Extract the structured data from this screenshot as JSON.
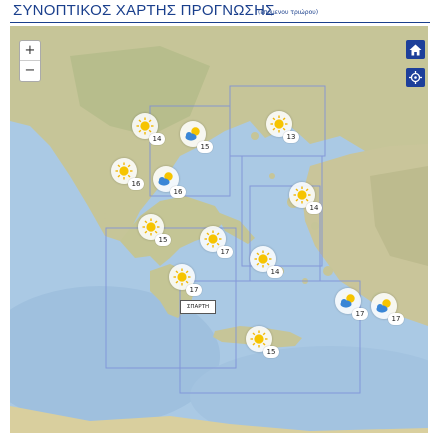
{
  "header": {
    "title": "ΣΥΝΟΠΤΙΚΟΣ ΧΑΡΤΗΣ ΠΡΟΓΝΩΣΗΣ",
    "subtitle": "(επόμενου τριώρου)"
  },
  "map": {
    "zoom_in_label": "+",
    "zoom_out_label": "−",
    "home_icon": "home-icon",
    "locate_icon": "crosshair-icon",
    "colors": {
      "sea": "#aac9e4",
      "land": "#c8c89a",
      "accent": "#1d3f9a",
      "region_border": "#7d8fd8"
    },
    "city_label": "ΣΠΑΡΤΗ",
    "forecasts": [
      {
        "weather": "sunny",
        "temp": "14"
      },
      {
        "weather": "partly-cloudy",
        "temp": "15"
      },
      {
        "weather": "sunny",
        "temp": "13"
      },
      {
        "weather": "sunny",
        "temp": "16"
      },
      {
        "weather": "partly-cloudy",
        "temp": "16"
      },
      {
        "weather": "sunny",
        "temp": "14"
      },
      {
        "weather": "sunny",
        "temp": "15"
      },
      {
        "weather": "sunny",
        "temp": "17"
      },
      {
        "weather": "sunny",
        "temp": "14"
      },
      {
        "weather": "sunny",
        "temp": "17"
      },
      {
        "weather": "partly-cloudy",
        "temp": "17"
      },
      {
        "weather": "partly-cloudy",
        "temp": "17"
      },
      {
        "weather": "sunny",
        "temp": "15"
      }
    ]
  }
}
